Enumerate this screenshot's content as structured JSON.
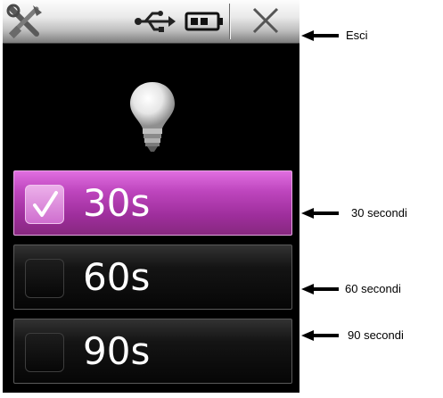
{
  "device": {
    "statusbar": {
      "icons": [
        "tools-icon",
        "usb-icon",
        "battery-icon"
      ],
      "close_icon": "close-icon"
    },
    "center_icon": "light-bulb-icon",
    "options": [
      {
        "label": "30s",
        "checked": true
      },
      {
        "label": "60s",
        "checked": false
      },
      {
        "label": "90s",
        "checked": false
      }
    ],
    "colors": {
      "selected": "#b43cb4",
      "background": "#000000"
    }
  },
  "annotations": {
    "close": "Esci",
    "opt1": "30 secondi",
    "opt2": "60 secondi",
    "opt3": "90 secondi"
  }
}
